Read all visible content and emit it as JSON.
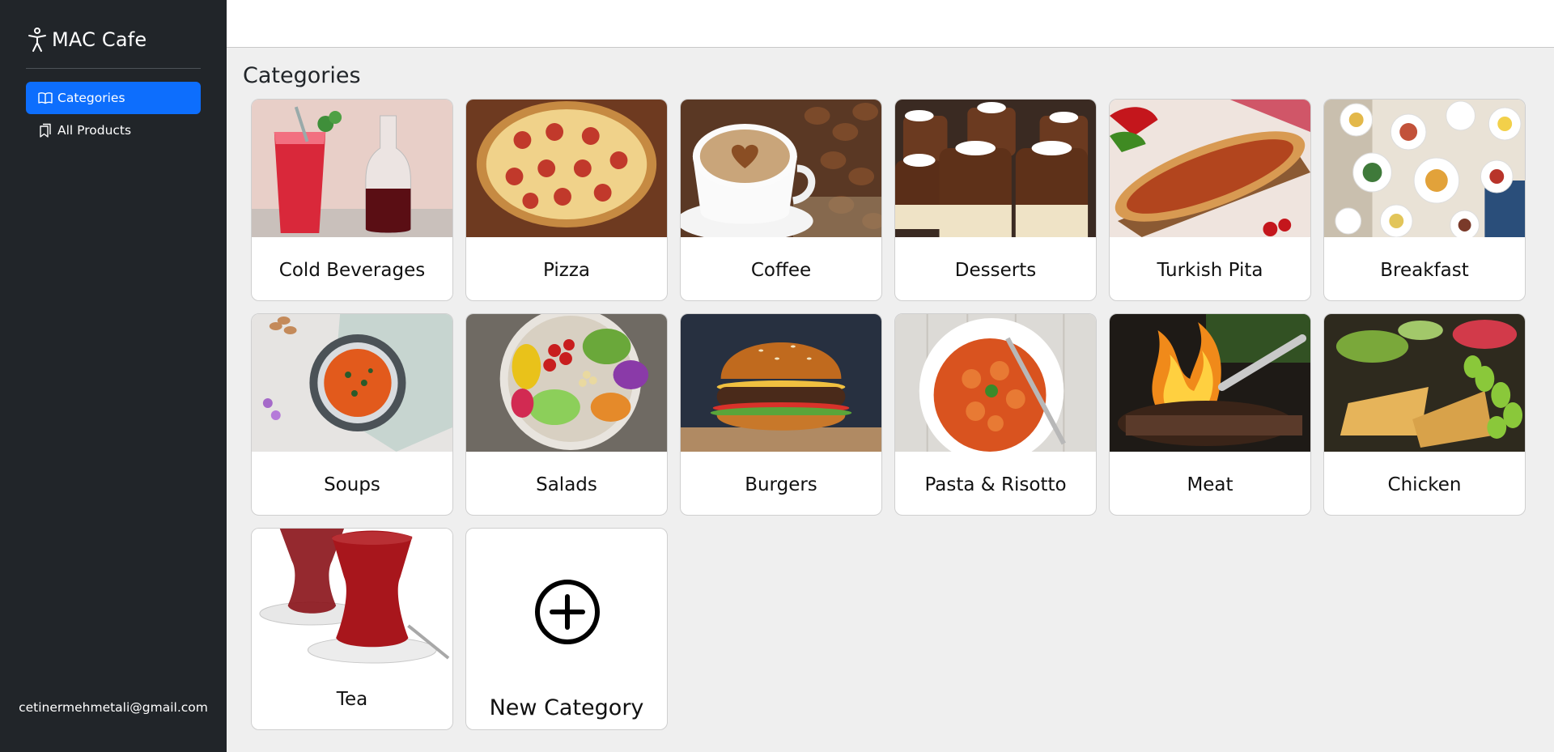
{
  "app": {
    "brand": "MAC Cafe",
    "user_email": "cetinermehmetali@gmail.com"
  },
  "sidebar": {
    "items": [
      {
        "label": "Categories",
        "icon": "book-open-icon",
        "active": true
      },
      {
        "label": "All Products",
        "icon": "bookmarks-icon",
        "active": false
      }
    ]
  },
  "main": {
    "title": "Categories",
    "categories": [
      {
        "label": "Cold Beverages",
        "image": "cold-beverages-photo"
      },
      {
        "label": "Pizza",
        "image": "pizza-photo"
      },
      {
        "label": "Coffee",
        "image": "coffee-photo"
      },
      {
        "label": "Desserts",
        "image": "desserts-photo"
      },
      {
        "label": "Turkish Pita",
        "image": "turkish-pita-photo"
      },
      {
        "label": "Breakfast",
        "image": "breakfast-photo"
      },
      {
        "label": "Soups",
        "image": "soups-photo"
      },
      {
        "label": "Salads",
        "image": "salads-photo"
      },
      {
        "label": "Burgers",
        "image": "burgers-photo"
      },
      {
        "label": "Pasta & Risotto",
        "image": "pasta-photo"
      },
      {
        "label": "Meat",
        "image": "meat-photo"
      },
      {
        "label": "Chicken",
        "image": "chicken-photo"
      },
      {
        "label": "Tea",
        "image": "tea-photo"
      }
    ],
    "new_category": {
      "label": "New Category",
      "icon": "plus-circle-icon"
    }
  },
  "colors": {
    "sidebar_bg": "#212529",
    "active_nav": "#0d6efd",
    "page_bg": "#efefef"
  }
}
